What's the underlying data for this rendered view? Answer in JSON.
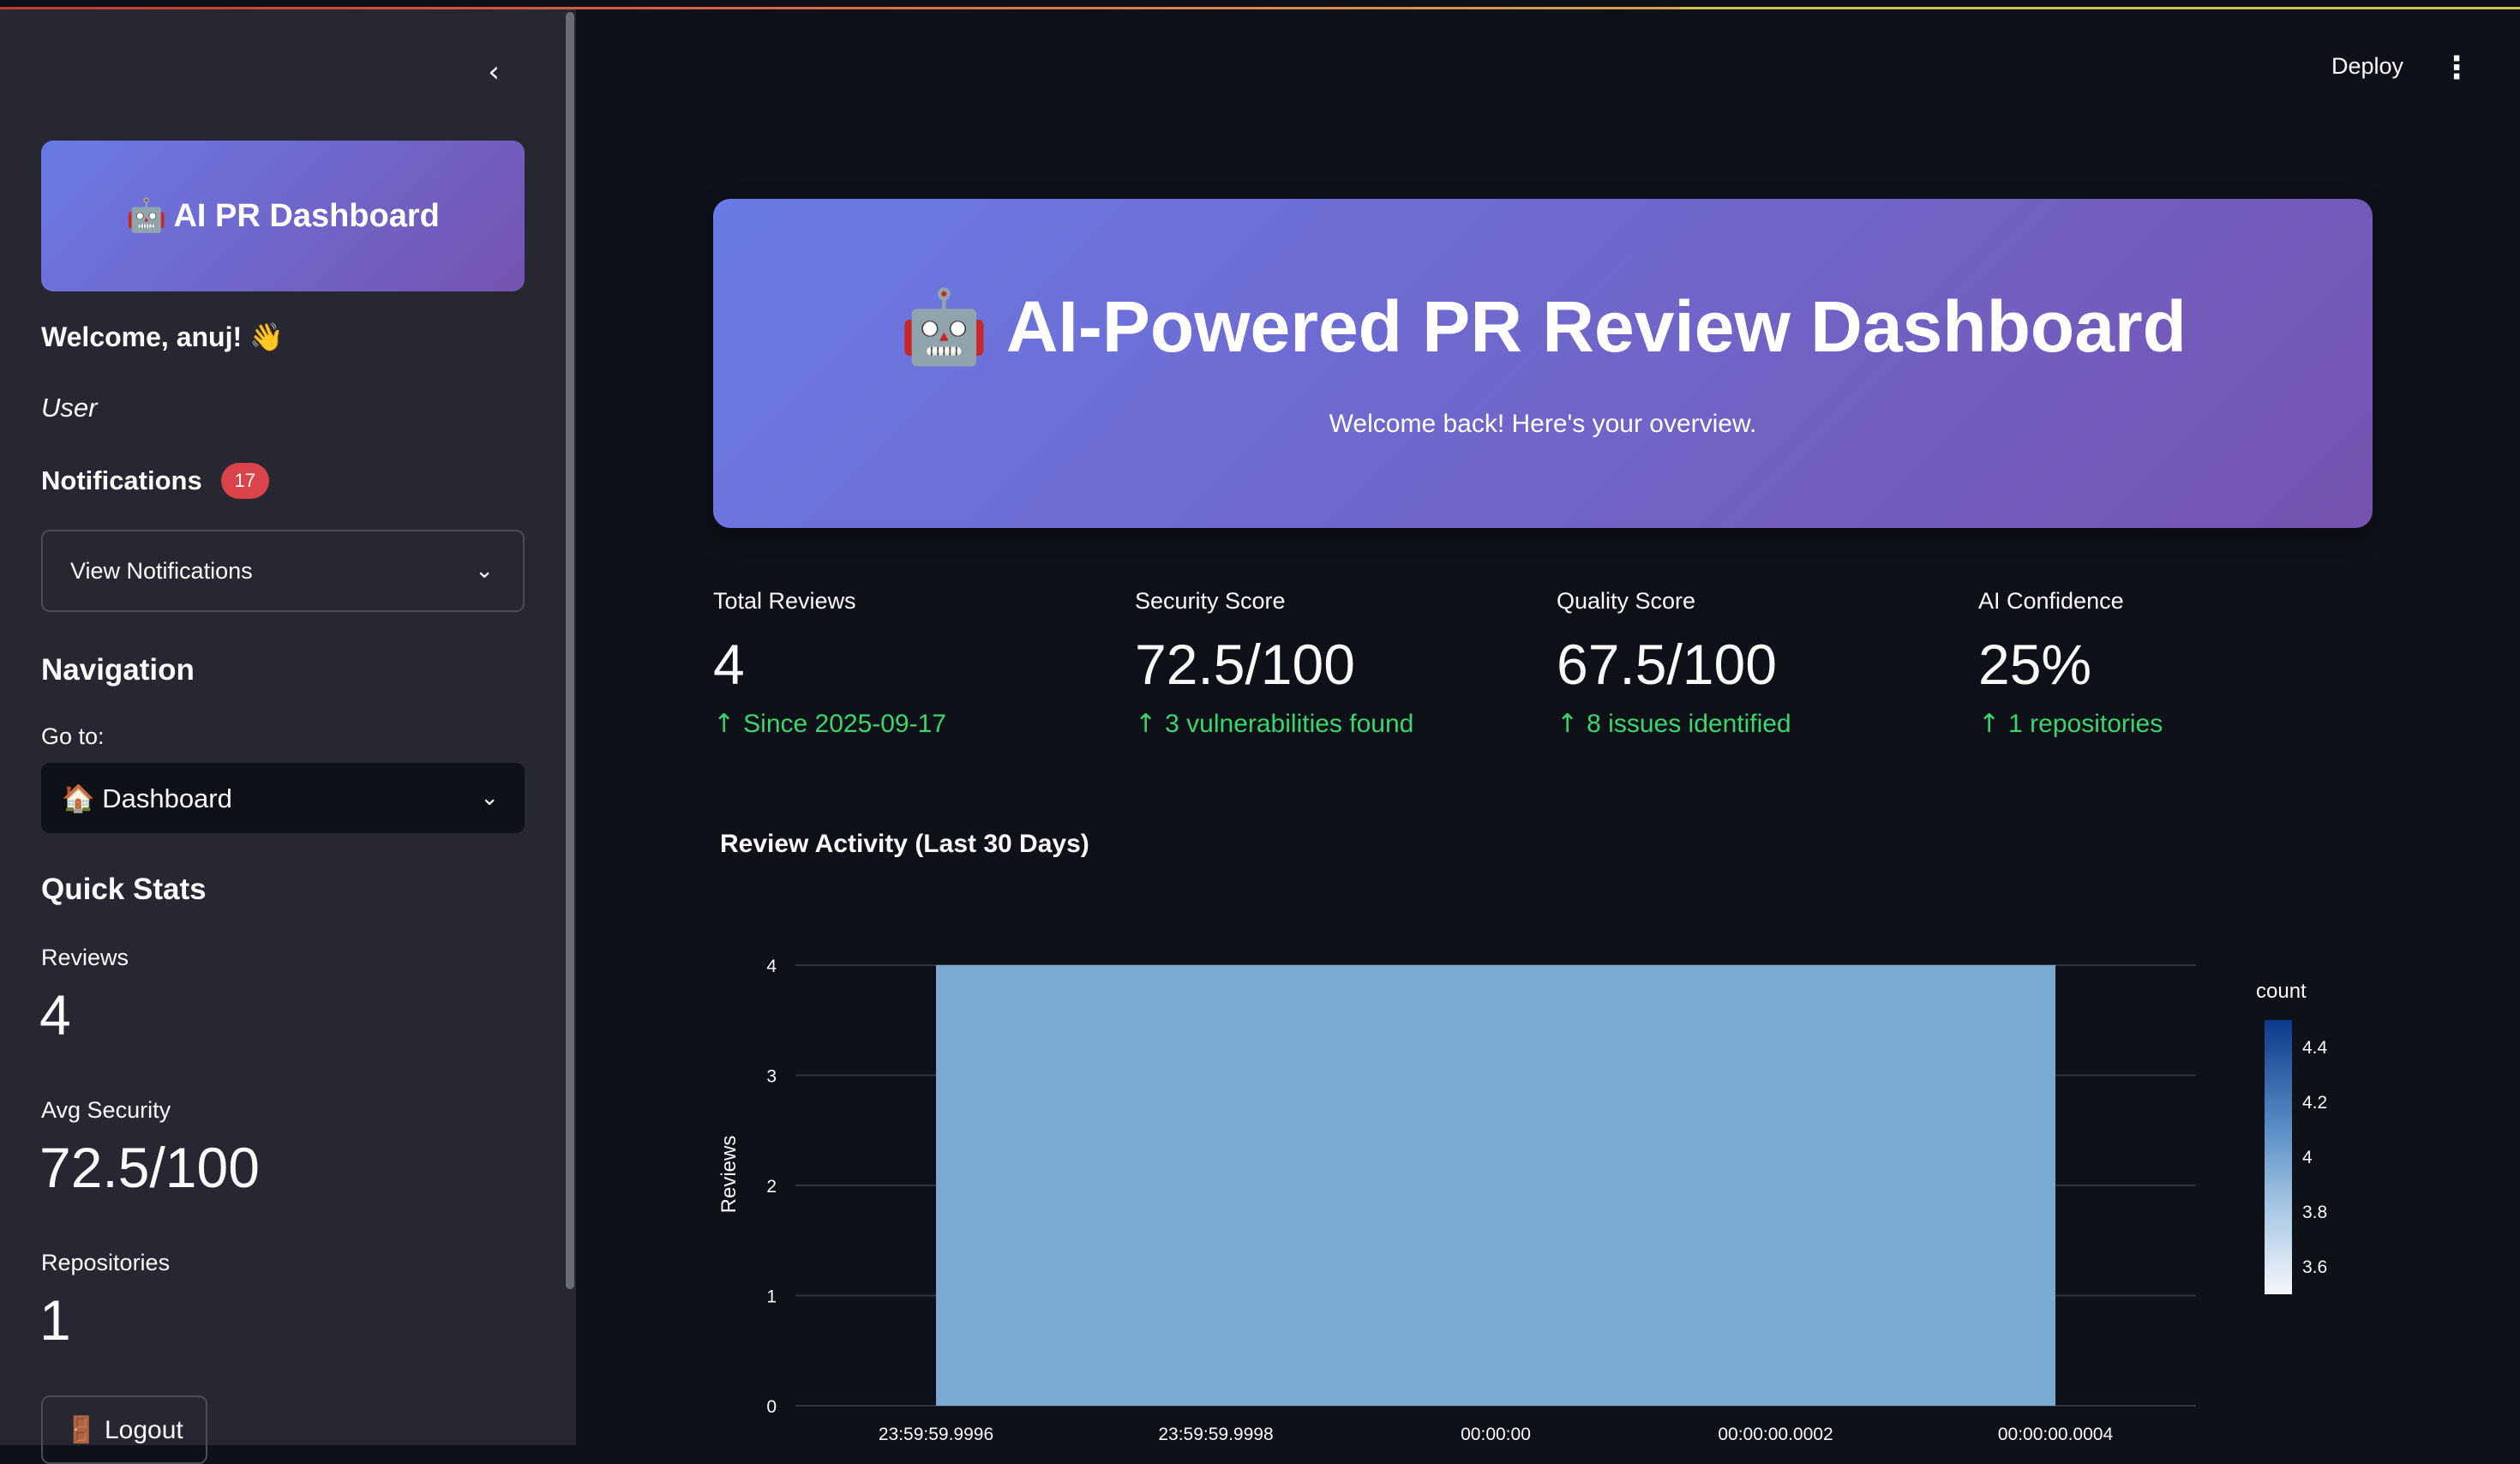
{
  "sidebar": {
    "brand": {
      "emoji": "🤖",
      "label": "AI PR Dashboard"
    },
    "welcome": "Welcome, anuj! 👋",
    "role": "User",
    "notifications": {
      "title": "Notifications",
      "count": "17",
      "expander_label": "View Notifications"
    },
    "navigation": {
      "title": "Navigation",
      "goto_label": "Go to:",
      "selected": "🏠 Dashboard"
    },
    "quick_stats": {
      "title": "Quick Stats",
      "items": [
        {
          "label": "Reviews",
          "value": "4"
        },
        {
          "label": "Avg Security",
          "value": "72.5/100"
        },
        {
          "label": "Repositories",
          "value": "1"
        }
      ]
    },
    "logout_label": "🚪 Logout"
  },
  "header": {
    "deploy_label": "Deploy"
  },
  "hero": {
    "title": "🤖 AI-Powered PR Review Dashboard",
    "subtitle": "Welcome back! Here's your overview."
  },
  "metrics": [
    {
      "label": "Total Reviews",
      "value": "4",
      "delta": "Since 2025-09-17"
    },
    {
      "label": "Security Score",
      "value": "72.5/100",
      "delta": "3 vulnerabilities found"
    },
    {
      "label": "Quality Score",
      "value": "67.5/100",
      "delta": "8 issues identified"
    },
    {
      "label": "AI Confidence",
      "value": "25%",
      "delta": "1 repositories"
    }
  ],
  "colors": {
    "accent_gradient_start": "#6a7be6",
    "accent_gradient_end": "#7553b0",
    "delta_green": "#3dd56d",
    "badge_red": "#d9444a",
    "bar_fill": "#7aaad0"
  },
  "chart_data": {
    "type": "bar",
    "title": "Review Activity (Last 30 Days)",
    "ylabel": "Reviews",
    "xlabel": "",
    "x_tick_labels": [
      "23:59:59.9996",
      "23:59:59.9998",
      "00:00:00",
      "00:00:00.0002",
      "00:00:00.0004"
    ],
    "y_ticks": [
      0,
      1,
      2,
      3,
      4
    ],
    "ylim": [
      0,
      4
    ],
    "bars": [
      {
        "x_start": "23:59:59.9996",
        "x_end": "00:00:00.0004",
        "count": 4
      }
    ],
    "colorbar": {
      "title": "count",
      "ticks": [
        "4.4",
        "4.2",
        "4",
        "3.8",
        "3.6"
      ],
      "range": [
        3.5,
        4.5
      ]
    },
    "grid": true
  }
}
